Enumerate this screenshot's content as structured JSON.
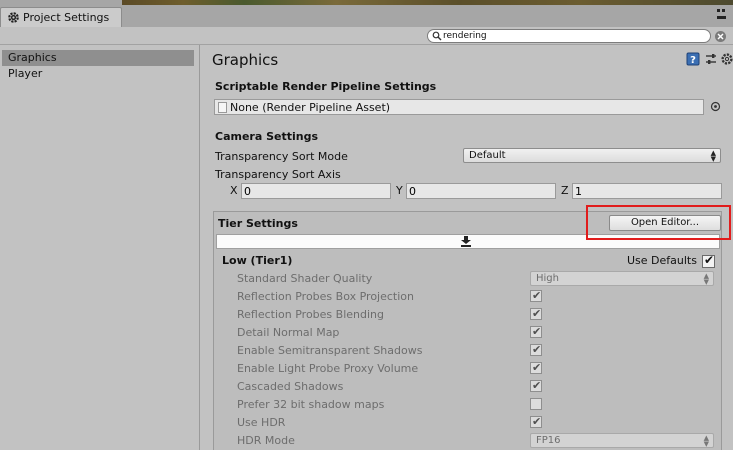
{
  "window": {
    "tab_title": "Project Settings"
  },
  "search": {
    "value": "rendering"
  },
  "sidebar": {
    "items": [
      {
        "label": "Graphics",
        "selected": true
      },
      {
        "label": "Player",
        "selected": false
      }
    ]
  },
  "main": {
    "title": "Graphics",
    "srp": {
      "section": "Scriptable Render Pipeline Settings",
      "value": "None (Render Pipeline Asset)"
    },
    "camera": {
      "section": "Camera Settings",
      "sort_mode_label": "Transparency Sort Mode",
      "sort_mode_value": "Default",
      "sort_axis_label": "Transparency Sort Axis",
      "x_label": "X",
      "x_value": "0",
      "y_label": "Y",
      "y_value": "0",
      "z_label": "Z",
      "z_value": "1"
    },
    "tier": {
      "section": "Tier Settings",
      "open_editor_label": "Open Editor...",
      "tier1_title": "Low (Tier1)",
      "use_defaults_label": "Use Defaults",
      "use_defaults_checked": true,
      "rows": [
        {
          "label": "Standard Shader Quality",
          "kind": "dropdown",
          "value": "High"
        },
        {
          "label": "Reflection Probes Box Projection",
          "kind": "checkbox",
          "checked": true
        },
        {
          "label": "Reflection Probes Blending",
          "kind": "checkbox",
          "checked": true
        },
        {
          "label": "Detail Normal Map",
          "kind": "checkbox",
          "checked": true
        },
        {
          "label": "Enable Semitransparent Shadows",
          "kind": "checkbox",
          "checked": true
        },
        {
          "label": "Enable Light Probe Proxy Volume",
          "kind": "checkbox",
          "checked": true
        },
        {
          "label": "Cascaded Shadows",
          "kind": "checkbox",
          "checked": true
        },
        {
          "label": "Prefer 32 bit shadow maps",
          "kind": "checkbox",
          "checked": false
        },
        {
          "label": "Use HDR",
          "kind": "checkbox",
          "checked": true
        },
        {
          "label": "HDR Mode",
          "kind": "dropdown",
          "value": "FP16"
        }
      ]
    }
  },
  "icons": {
    "window_tab": "gear-icon",
    "search": "magnifier-icon",
    "header": [
      "help-book-icon",
      "preset-sliders-icon",
      "settings-gear-icon"
    ],
    "picker": "object-picker-icon",
    "dropdown_arrow": "updown-arrow-icon"
  },
  "colors": {
    "highlight_border": "#e11c1c",
    "selected_item_bg": "#8f8f8f",
    "help_icon_blue": "#3b6fb3"
  }
}
